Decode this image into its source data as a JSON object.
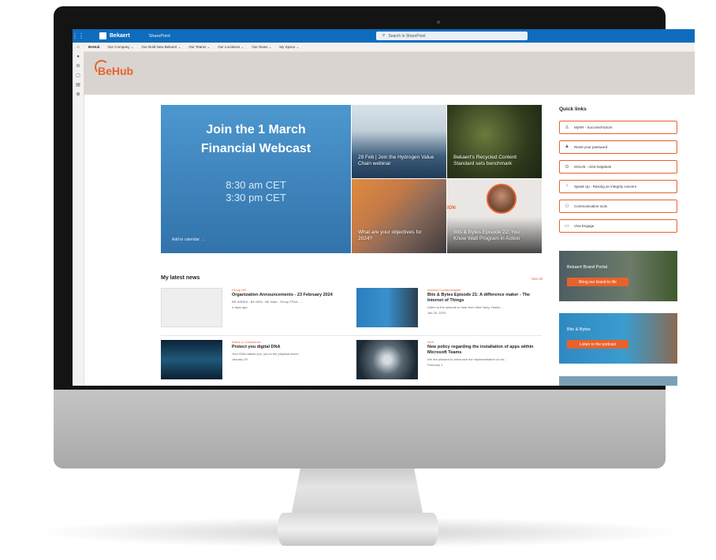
{
  "topbar": {
    "brand": "Bekaert",
    "app_name": "SharePoint",
    "search_placeholder": "Search in SharePoint"
  },
  "hubnav": {
    "items": [
      "BeHub",
      "Our Company ⌄",
      "Our Bold New Bekaert ⌄",
      "Our Teams ⌄",
      "Our Locations ⌄",
      "Our News ⌄",
      "My Space ⌄"
    ]
  },
  "header": {
    "logo": "BeHub"
  },
  "hero": {
    "title_line1": "Join the 1 March",
    "title_line2": "Financial Webcast",
    "time1": "8:30 am CET",
    "time2": "3:30 pm CET",
    "calendar_link": "Add to calendar →"
  },
  "tiles": [
    {
      "caption": "29 Feb | Join the Hydrogen Value Chain webinar"
    },
    {
      "caption": "Bekaert's Recycled Content Standard sets benchmark"
    },
    {
      "caption": "What are your objectives for 2024?"
    },
    {
      "caption": "Bits & Bytes Episode 22: You Know Watt Program in Action",
      "badge": "ION"
    }
  ],
  "quick_links": {
    "title": "Quick links",
    "items": [
      {
        "label": "MyHR - SuccessFactors",
        "icon": "person-icon"
      },
      {
        "label": "Reset your password",
        "icon": "lock-icon"
      },
      {
        "label": "SOLVE - ADS helpdesk",
        "icon": "support-icon"
      },
      {
        "label": "Speak Up - Raising an integrity concern",
        "icon": "microphone-icon"
      },
      {
        "label": "Communication tools",
        "icon": "people-icon"
      },
      {
        "label": "Viva Engage",
        "icon": "chat-icon"
      }
    ]
  },
  "promos": [
    {
      "label": "Bekaert Brand Portal",
      "button": "Bring our brand to life"
    },
    {
      "label": "Bits & Bytes",
      "button": "Listen to the podcast"
    }
  ],
  "news": {
    "title": "My latest news",
    "see_all": "See all",
    "items": [
      {
        "category": "Group HR",
        "headline": "Organization Announcements - 23 February 2024",
        "summary": "BR NSDEA - BK MEA - BK India - Group FP&A - ...",
        "date": "4 days ago"
      },
      {
        "category": "Internal Communication",
        "headline": "Bits & Bytes Episode 21: A difference maker - The Internet of Things",
        "summary": "Listen to the episode to hear from Nick Yang, Harish...",
        "date": "Jan 29, 2024"
      },
      {
        "category": "Ethics & Compliance",
        "headline": "Protect you digital DNA",
        "summary": "Your DNA makes you, you in the physical world...",
        "date": "January 29"
      },
      {
        "category": "ADS",
        "headline": "New policy regarding the installation of apps within Microsoft Teams",
        "summary": "We are pleased to announce the implementation of our...",
        "date": "February 1"
      }
    ]
  }
}
